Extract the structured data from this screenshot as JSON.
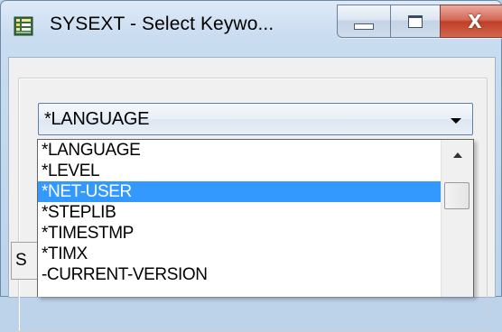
{
  "window": {
    "title": "SYSEXT - Select Keywo...",
    "icon": "app-grid-icon",
    "caption_buttons": {
      "minimize": "minimize-icon",
      "maximize": "maximize-icon",
      "close": "X"
    }
  },
  "combo": {
    "selected_value": "*LANGUAGE",
    "arrow_icon": "chevron-down-icon"
  },
  "dropdown": {
    "items": [
      "*LANGUAGE",
      "*LEVEL",
      "*NET-USER",
      "*STEPLIB",
      "*TIMESTMP",
      "*TIMX",
      "-CURRENT-VERSION"
    ],
    "highlighted_index": 2
  },
  "status": {
    "label": "S"
  },
  "colors": {
    "selection": "#3399ff",
    "close_button": "#c23e27",
    "window_frame": "#bcd3ea"
  }
}
